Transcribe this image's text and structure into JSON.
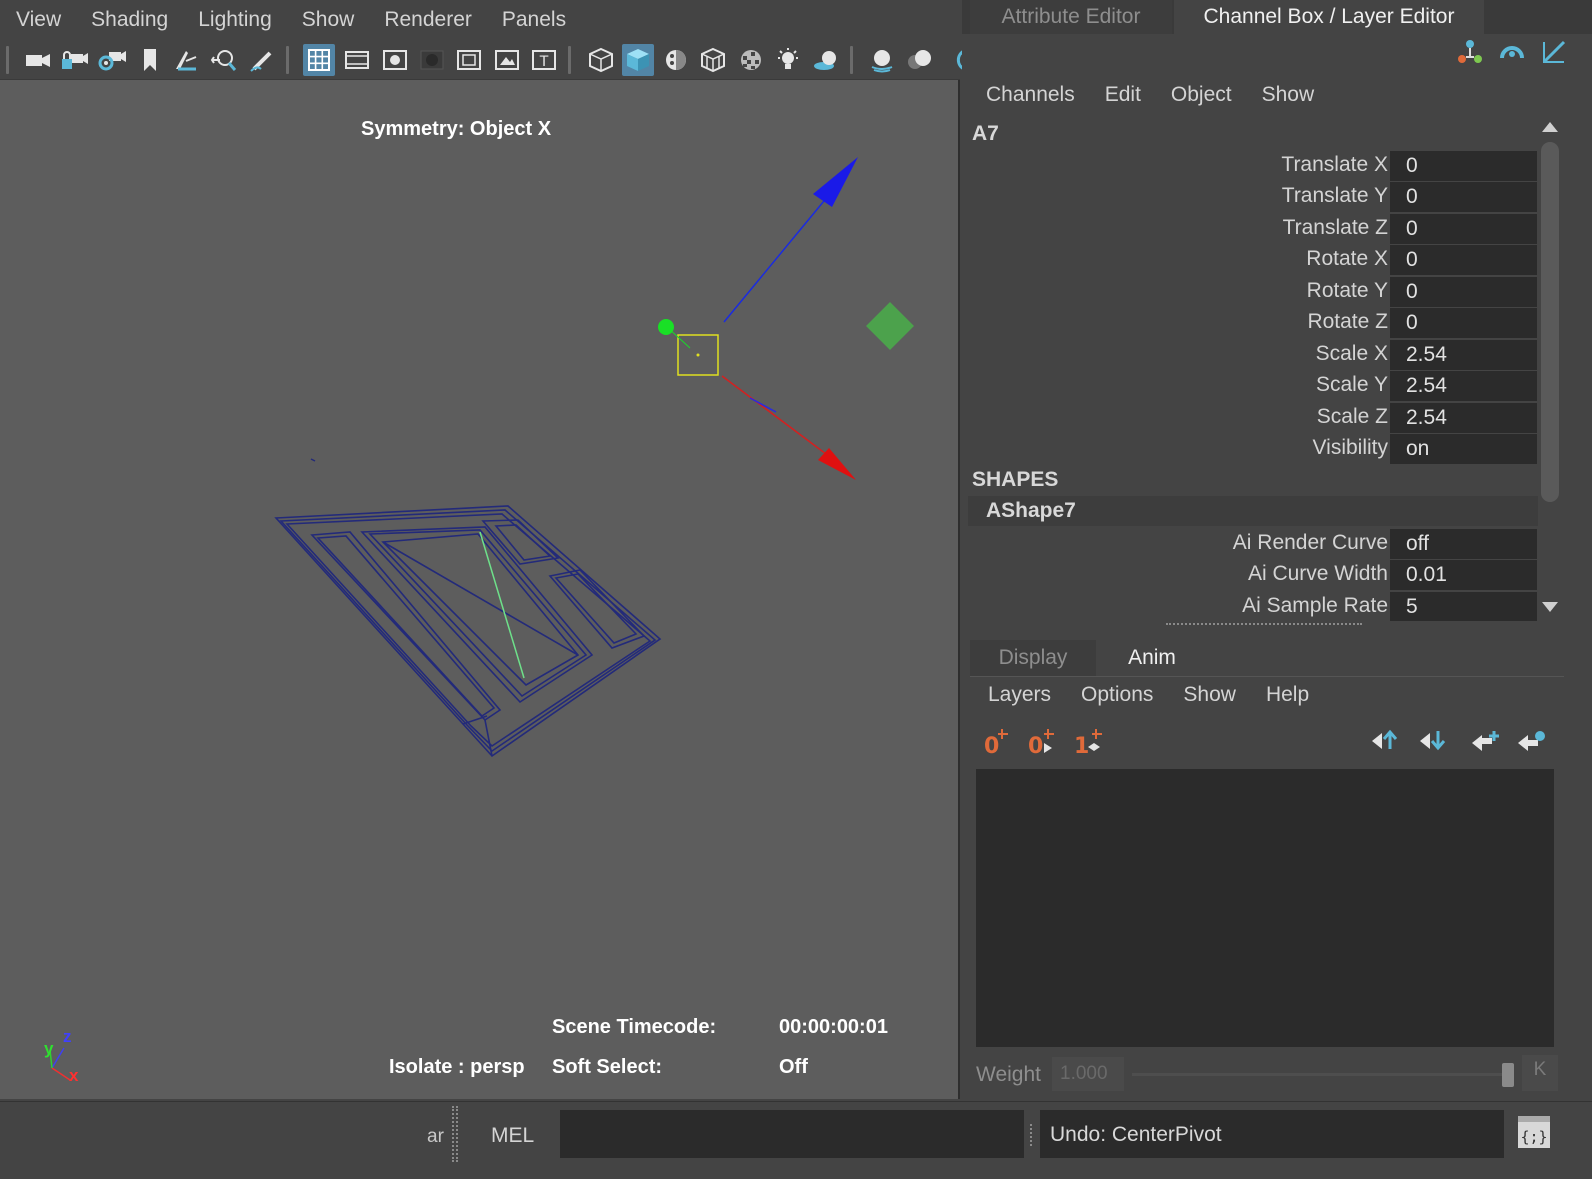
{
  "viewport": {
    "menu": [
      "View",
      "Shading",
      "Lighting",
      "Show",
      "Renderer",
      "Panels"
    ],
    "hud": {
      "symmetry": "Symmetry: Object X",
      "scene_timecode_label": "Scene Timecode:",
      "scene_timecode_value": "00:00:00:01",
      "isolate": "Isolate : persp",
      "soft_select_label": "Soft Select:",
      "soft_select_value": "Off"
    },
    "axis_labels": {
      "y": "y",
      "z": "z",
      "x": "x"
    }
  },
  "editor_tabs": [
    "Attribute Editor",
    "Channel Box / Layer Editor"
  ],
  "channel_box": {
    "menu": [
      "Channels",
      "Edit",
      "Object",
      "Show"
    ],
    "object_name": "A7",
    "channels": [
      {
        "label": "Translate X",
        "value": "0"
      },
      {
        "label": "Translate Y",
        "value": "0"
      },
      {
        "label": "Translate Z",
        "value": "0"
      },
      {
        "label": "Rotate X",
        "value": "0"
      },
      {
        "label": "Rotate Y",
        "value": "0"
      },
      {
        "label": "Rotate Z",
        "value": "0"
      },
      {
        "label": "Scale X",
        "value": "2.54"
      },
      {
        "label": "Scale Y",
        "value": "2.54"
      },
      {
        "label": "Scale Z",
        "value": "2.54"
      },
      {
        "label": "Visibility",
        "value": "on"
      }
    ],
    "shapes_header": "SHAPES",
    "shape_name": "AShape7",
    "shape_channels": [
      {
        "label": "Ai Render Curve",
        "value": "off"
      },
      {
        "label": "Ai Curve Width",
        "value": "0.01"
      },
      {
        "label": "Ai Sample Rate",
        "value": "5"
      }
    ]
  },
  "layer_editor": {
    "tabs": [
      "Display",
      "Anim"
    ],
    "menu": [
      "Layers",
      "Options",
      "Show",
      "Help"
    ],
    "weight_label": "Weight",
    "weight_value": "1.000",
    "key_label": "K"
  },
  "command_line": {
    "truncated_text": "ar",
    "language": "MEL",
    "result": "Undo: CenterPivot"
  },
  "colors": {
    "accent_blue": "#5285a6",
    "viewport_bg": "#5d5d5d",
    "panel_bg": "#444444",
    "field_bg": "#2b2b2b",
    "key_orange": "#e06a3a",
    "icon_teal": "#5bb8d8"
  }
}
